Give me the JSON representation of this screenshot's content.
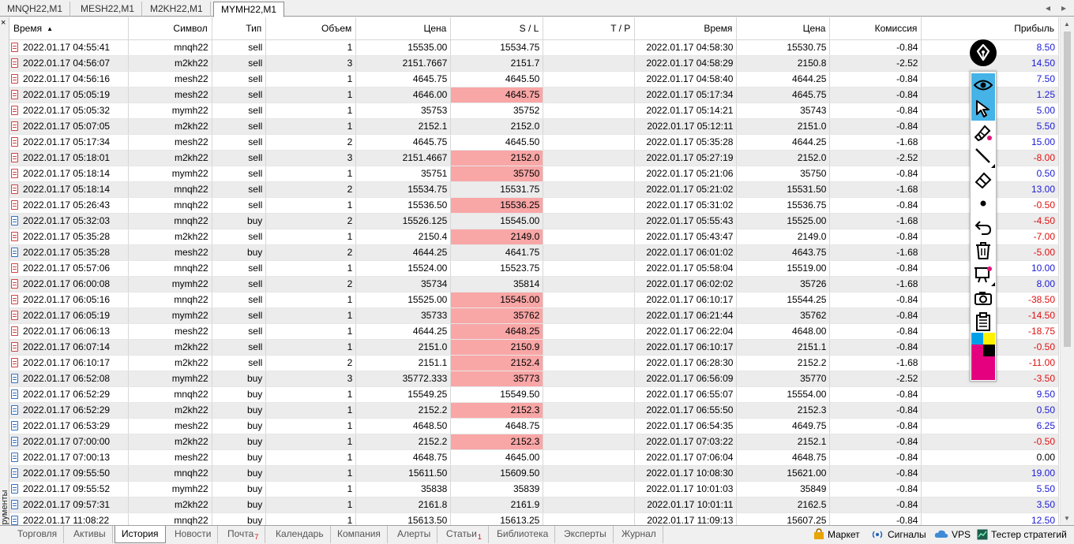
{
  "chart_tabs": [
    {
      "label": "MNQH22,M1",
      "active": false
    },
    {
      "label": "MESH22,M1",
      "active": false
    },
    {
      "label": "M2KH22,M1",
      "active": false
    },
    {
      "label": "MYMH22,M1",
      "active": true
    }
  ],
  "chart_tab_arrows": {
    "left": "◂",
    "right": "▸"
  },
  "toolbox": {
    "close_glyph": "×",
    "label": "Инструменты"
  },
  "table": {
    "columns": [
      "Время",
      "Символ",
      "Тип",
      "Объем",
      "Цена",
      "S / L",
      "T / P",
      "Время",
      "Цена",
      "Комиссия",
      "Прибыль"
    ],
    "sort_indicator": "▲",
    "rows": [
      {
        "open_time": "2022.01.17 04:55:41",
        "symbol": "mnqh22",
        "type": "sell",
        "volume": "1",
        "price": "15535.00",
        "sl": "15534.75",
        "tp": "",
        "close_time": "2022.01.17 04:58:30",
        "close_price": "15530.75",
        "commission": "-0.84",
        "profit": "8.50",
        "sl_hit": false
      },
      {
        "open_time": "2022.01.17 04:56:07",
        "symbol": "m2kh22",
        "type": "sell",
        "volume": "3",
        "price": "2151.7667",
        "sl": "2151.7",
        "tp": "",
        "close_time": "2022.01.17 04:58:29",
        "close_price": "2150.8",
        "commission": "-2.52",
        "profit": "14.50",
        "sl_hit": false
      },
      {
        "open_time": "2022.01.17 04:56:16",
        "symbol": "mesh22",
        "type": "sell",
        "volume": "1",
        "price": "4645.75",
        "sl": "4645.50",
        "tp": "",
        "close_time": "2022.01.17 04:58:40",
        "close_price": "4644.25",
        "commission": "-0.84",
        "profit": "7.50",
        "sl_hit": false
      },
      {
        "open_time": "2022.01.17 05:05:19",
        "symbol": "mesh22",
        "type": "sell",
        "volume": "1",
        "price": "4646.00",
        "sl": "4645.75",
        "tp": "",
        "close_time": "2022.01.17 05:17:34",
        "close_price": "4645.75",
        "commission": "-0.84",
        "profit": "1.25",
        "sl_hit": true
      },
      {
        "open_time": "2022.01.17 05:05:32",
        "symbol": "mymh22",
        "type": "sell",
        "volume": "1",
        "price": "35753",
        "sl": "35752",
        "tp": "",
        "close_time": "2022.01.17 05:14:21",
        "close_price": "35743",
        "commission": "-0.84",
        "profit": "5.00",
        "sl_hit": false
      },
      {
        "open_time": "2022.01.17 05:07:05",
        "symbol": "m2kh22",
        "type": "sell",
        "volume": "1",
        "price": "2152.1",
        "sl": "2152.0",
        "tp": "",
        "close_time": "2022.01.17 05:12:11",
        "close_price": "2151.0",
        "commission": "-0.84",
        "profit": "5.50",
        "sl_hit": false
      },
      {
        "open_time": "2022.01.17 05:17:34",
        "symbol": "mesh22",
        "type": "sell",
        "volume": "2",
        "price": "4645.75",
        "sl": "4645.50",
        "tp": "",
        "close_time": "2022.01.17 05:35:28",
        "close_price": "4644.25",
        "commission": "-1.68",
        "profit": "15.00",
        "sl_hit": false
      },
      {
        "open_time": "2022.01.17 05:18:01",
        "symbol": "m2kh22",
        "type": "sell",
        "volume": "3",
        "price": "2151.4667",
        "sl": "2152.0",
        "tp": "",
        "close_time": "2022.01.17 05:27:19",
        "close_price": "2152.0",
        "commission": "-2.52",
        "profit": "-8.00",
        "sl_hit": true
      },
      {
        "open_time": "2022.01.17 05:18:14",
        "symbol": "mymh22",
        "type": "sell",
        "volume": "1",
        "price": "35751",
        "sl": "35750",
        "tp": "",
        "close_time": "2022.01.17 05:21:06",
        "close_price": "35750",
        "commission": "-0.84",
        "profit": "0.50",
        "sl_hit": true
      },
      {
        "open_time": "2022.01.17 05:18:14",
        "symbol": "mnqh22",
        "type": "sell",
        "volume": "2",
        "price": "15534.75",
        "sl": "15531.75",
        "tp": "",
        "close_time": "2022.01.17 05:21:02",
        "close_price": "15531.50",
        "commission": "-1.68",
        "profit": "13.00",
        "sl_hit": false
      },
      {
        "open_time": "2022.01.17 05:26:43",
        "symbol": "mnqh22",
        "type": "sell",
        "volume": "1",
        "price": "15536.50",
        "sl": "15536.25",
        "tp": "",
        "close_time": "2022.01.17 05:31:02",
        "close_price": "15536.75",
        "commission": "-0.84",
        "profit": "-0.50",
        "sl_hit": true
      },
      {
        "open_time": "2022.01.17 05:32:03",
        "symbol": "mnqh22",
        "type": "buy",
        "volume": "2",
        "price": "15526.125",
        "sl": "15545.00",
        "tp": "",
        "close_time": "2022.01.17 05:55:43",
        "close_price": "15525.00",
        "commission": "-1.68",
        "profit": "-4.50",
        "sl_hit": false
      },
      {
        "open_time": "2022.01.17 05:35:28",
        "symbol": "m2kh22",
        "type": "sell",
        "volume": "1",
        "price": "2150.4",
        "sl": "2149.0",
        "tp": "",
        "close_time": "2022.01.17 05:43:47",
        "close_price": "2149.0",
        "commission": "-0.84",
        "profit": "-7.00",
        "sl_hit": true
      },
      {
        "open_time": "2022.01.17 05:35:28",
        "symbol": "mesh22",
        "type": "buy",
        "volume": "2",
        "price": "4644.25",
        "sl": "4641.75",
        "tp": "",
        "close_time": "2022.01.17 06:01:02",
        "close_price": "4643.75",
        "commission": "-1.68",
        "profit": "-5.00",
        "sl_hit": false
      },
      {
        "open_time": "2022.01.17 05:57:06",
        "symbol": "mnqh22",
        "type": "sell",
        "volume": "1",
        "price": "15524.00",
        "sl": "15523.75",
        "tp": "",
        "close_time": "2022.01.17 05:58:04",
        "close_price": "15519.00",
        "commission": "-0.84",
        "profit": "10.00",
        "sl_hit": false
      },
      {
        "open_time": "2022.01.17 06:00:08",
        "symbol": "mymh22",
        "type": "sell",
        "volume": "2",
        "price": "35734",
        "sl": "35814",
        "tp": "",
        "close_time": "2022.01.17 06:02:02",
        "close_price": "35726",
        "commission": "-1.68",
        "profit": "8.00",
        "sl_hit": false
      },
      {
        "open_time": "2022.01.17 06:05:16",
        "symbol": "mnqh22",
        "type": "sell",
        "volume": "1",
        "price": "15525.00",
        "sl": "15545.00",
        "tp": "",
        "close_time": "2022.01.17 06:10:17",
        "close_price": "15544.25",
        "commission": "-0.84",
        "profit": "-38.50",
        "sl_hit": true
      },
      {
        "open_time": "2022.01.17 06:05:19",
        "symbol": "mymh22",
        "type": "sell",
        "volume": "1",
        "price": "35733",
        "sl": "35762",
        "tp": "",
        "close_time": "2022.01.17 06:21:44",
        "close_price": "35762",
        "commission": "-0.84",
        "profit": "-14.50",
        "sl_hit": true
      },
      {
        "open_time": "2022.01.17 06:06:13",
        "symbol": "mesh22",
        "type": "sell",
        "volume": "1",
        "price": "4644.25",
        "sl": "4648.25",
        "tp": "",
        "close_time": "2022.01.17 06:22:04",
        "close_price": "4648.00",
        "commission": "-0.84",
        "profit": "-18.75",
        "sl_hit": true
      },
      {
        "open_time": "2022.01.17 06:07:14",
        "symbol": "m2kh22",
        "type": "sell",
        "volume": "1",
        "price": "2151.0",
        "sl": "2150.9",
        "tp": "",
        "close_time": "2022.01.17 06:10:17",
        "close_price": "2151.1",
        "commission": "-0.84",
        "profit": "-0.50",
        "sl_hit": true
      },
      {
        "open_time": "2022.01.17 06:10:17",
        "symbol": "m2kh22",
        "type": "sell",
        "volume": "2",
        "price": "2151.1",
        "sl": "2152.4",
        "tp": "",
        "close_time": "2022.01.17 06:28:30",
        "close_price": "2152.2",
        "commission": "-1.68",
        "profit": "-11.00",
        "sl_hit": true
      },
      {
        "open_time": "2022.01.17 06:52:08",
        "symbol": "mymh22",
        "type": "buy",
        "volume": "3",
        "price": "35772.333",
        "sl": "35773",
        "tp": "",
        "close_time": "2022.01.17 06:56:09",
        "close_price": "35770",
        "commission": "-2.52",
        "profit": "-3.50",
        "sl_hit": true
      },
      {
        "open_time": "2022.01.17 06:52:29",
        "symbol": "mnqh22",
        "type": "buy",
        "volume": "1",
        "price": "15549.25",
        "sl": "15549.50",
        "tp": "",
        "close_time": "2022.01.17 06:55:07",
        "close_price": "15554.00",
        "commission": "-0.84",
        "profit": "9.50",
        "sl_hit": false
      },
      {
        "open_time": "2022.01.17 06:52:29",
        "symbol": "m2kh22",
        "type": "buy",
        "volume": "1",
        "price": "2152.2",
        "sl": "2152.3",
        "tp": "",
        "close_time": "2022.01.17 06:55:50",
        "close_price": "2152.3",
        "commission": "-0.84",
        "profit": "0.50",
        "sl_hit": true
      },
      {
        "open_time": "2022.01.17 06:53:29",
        "symbol": "mesh22",
        "type": "buy",
        "volume": "1",
        "price": "4648.50",
        "sl": "4648.75",
        "tp": "",
        "close_time": "2022.01.17 06:54:35",
        "close_price": "4649.75",
        "commission": "-0.84",
        "profit": "6.25",
        "sl_hit": false
      },
      {
        "open_time": "2022.01.17 07:00:00",
        "symbol": "m2kh22",
        "type": "buy",
        "volume": "1",
        "price": "2152.2",
        "sl": "2152.3",
        "tp": "",
        "close_time": "2022.01.17 07:03:22",
        "close_price": "2152.1",
        "commission": "-0.84",
        "profit": "-0.50",
        "sl_hit": true
      },
      {
        "open_time": "2022.01.17 07:00:13",
        "symbol": "mesh22",
        "type": "buy",
        "volume": "1",
        "price": "4648.75",
        "sl": "4645.00",
        "tp": "",
        "close_time": "2022.01.17 07:06:04",
        "close_price": "4648.75",
        "commission": "-0.84",
        "profit": "0.00",
        "sl_hit": false
      },
      {
        "open_time": "2022.01.17 09:55:50",
        "symbol": "mnqh22",
        "type": "buy",
        "volume": "1",
        "price": "15611.50",
        "sl": "15609.50",
        "tp": "",
        "close_time": "2022.01.17 10:08:30",
        "close_price": "15621.00",
        "commission": "-0.84",
        "profit": "19.00",
        "sl_hit": false
      },
      {
        "open_time": "2022.01.17 09:55:52",
        "symbol": "mymh22",
        "type": "buy",
        "volume": "1",
        "price": "35838",
        "sl": "35839",
        "tp": "",
        "close_time": "2022.01.17 10:01:03",
        "close_price": "35849",
        "commission": "-0.84",
        "profit": "5.50",
        "sl_hit": false
      },
      {
        "open_time": "2022.01.17 09:57:31",
        "symbol": "m2kh22",
        "type": "buy",
        "volume": "1",
        "price": "2161.8",
        "sl": "2161.9",
        "tp": "",
        "close_time": "2022.01.17 10:01:11",
        "close_price": "2162.5",
        "commission": "-0.84",
        "profit": "3.50",
        "sl_hit": false
      },
      {
        "open_time": "2022.01.17 11:08:22",
        "symbol": "mnqh22",
        "type": "buy",
        "volume": "1",
        "price": "15613.50",
        "sl": "15613.25",
        "tp": "",
        "close_time": "2022.01.17 11:09:13",
        "close_price": "15607.25",
        "commission": "-0.84",
        "profit": "12.50",
        "sl_hit": false
      }
    ]
  },
  "drawing_toolbar": {
    "tools": [
      "eye-icon",
      "cursor-arrow-icon",
      "highlighter-icon",
      "line-pen-icon",
      "eraser-icon",
      "dot-brush-icon",
      "undo-icon",
      "trash-icon",
      "slideshow-icon",
      "camera-icon",
      "clipboard-icon"
    ],
    "palette_colors": [
      "#00a0e9",
      "#fff100",
      "#e4007f",
      "#000000"
    ],
    "accent": "#45b3e7"
  },
  "bottom_tabs": [
    {
      "label": "Торговля",
      "badge": ""
    },
    {
      "label": "Активы",
      "badge": ""
    },
    {
      "label": "История",
      "badge": "",
      "active": true
    },
    {
      "label": "Новости",
      "badge": ""
    },
    {
      "label": "Почта",
      "badge": "7"
    },
    {
      "label": "Календарь",
      "badge": ""
    },
    {
      "label": "Компания",
      "badge": ""
    },
    {
      "label": "Алерты",
      "badge": ""
    },
    {
      "label": "Статьи",
      "badge": "1"
    },
    {
      "label": "Библиотека",
      "badge": ""
    },
    {
      "label": "Эксперты",
      "badge": ""
    },
    {
      "label": "Журнал",
      "badge": ""
    }
  ],
  "right_links": [
    {
      "label": "Маркет",
      "icon": "market-bag-icon"
    },
    {
      "label": "Сигналы",
      "icon": "signals-antenna-icon"
    },
    {
      "label": "VPS",
      "icon": "cloud-icon"
    },
    {
      "label": "Тестер стратегий",
      "icon": "strategy-tester-icon"
    }
  ],
  "colors": {
    "profit_positive": "#1a1ad6",
    "profit_negative": "#e01010",
    "sl_highlight": "#f9a6a6",
    "sell_icon": "#d04040",
    "buy_icon": "#2f6fc0"
  }
}
